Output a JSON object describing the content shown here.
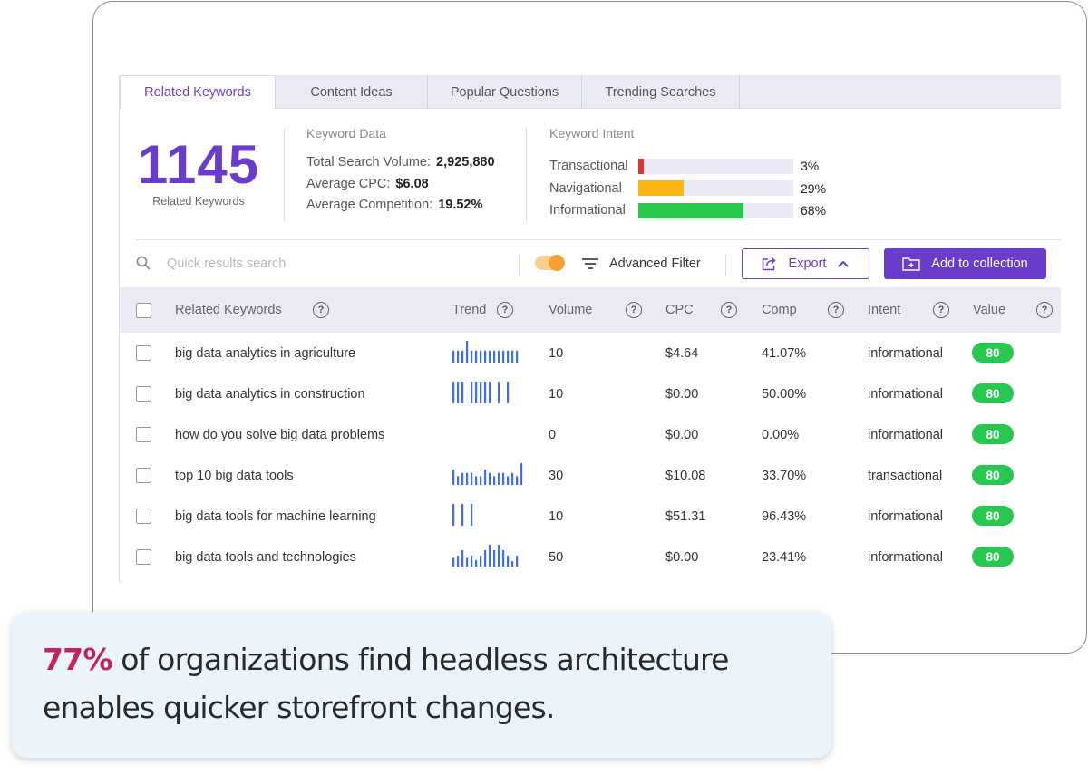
{
  "tabs": [
    {
      "label": "Related Keywords",
      "active": true
    },
    {
      "label": "Content Ideas",
      "active": false
    },
    {
      "label": "Popular Questions",
      "active": false
    },
    {
      "label": "Trending Searches",
      "active": false
    }
  ],
  "summary": {
    "count": "1145",
    "count_label": "Related Keywords",
    "keyword_data": {
      "title": "Keyword Data",
      "rows": [
        {
          "label": "Total Search Volume:",
          "value": "2,925,880"
        },
        {
          "label": "Average CPC:",
          "value": "$6.08"
        },
        {
          "label": "Average Competition:",
          "value": "19.52%"
        }
      ]
    },
    "keyword_intent": {
      "title": "Keyword Intent",
      "rows": [
        {
          "label": "Transactional",
          "value": "3%",
          "percent": 3,
          "color": "#d63a2a"
        },
        {
          "label": "Navigational",
          "value": "29%",
          "percent": 29,
          "color": "#fbb614"
        },
        {
          "label": "Informational",
          "value": "68%",
          "percent": 68,
          "color": "#28c850"
        }
      ]
    }
  },
  "toolbar": {
    "search_placeholder": "Quick results search",
    "search_value": "",
    "toggle_on": true,
    "advanced_filter_label": "Advanced Filter",
    "export_label": "Export",
    "add_collection_label": "Add to collection"
  },
  "table": {
    "headers": {
      "keyword": "Related Keywords",
      "trend": "Trend",
      "volume": "Volume",
      "cpc": "CPC",
      "comp": "Comp",
      "intent": "Intent",
      "value": "Value"
    },
    "help_glyph": "?",
    "rows": [
      {
        "keyword": "big data analytics in agriculture",
        "volume": "10",
        "cpc": "$4.64",
        "comp": "41.07%",
        "intent": "informational",
        "value": "80",
        "trend": [
          0.55,
          0.55,
          0.55,
          1.0,
          0.55,
          0.55,
          0.55,
          0.55,
          0.55,
          0.55,
          0.55,
          0.55,
          0.55,
          0.55,
          0.55
        ]
      },
      {
        "keyword": "big data analytics in construction",
        "volume": "10",
        "cpc": "$0.00",
        "comp": "50.00%",
        "intent": "informational",
        "value": "80",
        "trend": [
          1,
          1,
          1,
          0,
          1,
          1,
          1,
          1,
          1,
          0,
          1,
          0,
          1
        ]
      },
      {
        "keyword": "how do you solve big data problems",
        "volume": "0",
        "cpc": "$0.00",
        "comp": "0.00%",
        "intent": "informational",
        "value": "80",
        "trend": []
      },
      {
        "keyword": "top 10 big data tools",
        "volume": "30",
        "cpc": "$10.08",
        "comp": "33.70%",
        "intent": "transactional",
        "value": "80",
        "trend": [
          0.7,
          0.4,
          0.55,
          0.55,
          0.55,
          0.4,
          0.4,
          0.7,
          0.55,
          0.4,
          0.55,
          0.55,
          0.4,
          0.55,
          0.4,
          1.0
        ]
      },
      {
        "keyword": "big data tools for machine learning",
        "volume": "10",
        "cpc": "$51.31",
        "comp": "96.43%",
        "intent": "informational",
        "value": "80",
        "trend": [
          1,
          0,
          1,
          0,
          1
        ]
      },
      {
        "keyword": "big data tools and technologies",
        "volume": "50",
        "cpc": "$0.00",
        "comp": "23.41%",
        "intent": "informational",
        "value": "80",
        "trend": [
          0.4,
          0.5,
          0.75,
          0.4,
          0.5,
          0.3,
          0.5,
          0.75,
          1.0,
          0.75,
          1.0,
          0.75,
          0.5,
          0.25,
          0.5
        ]
      }
    ]
  },
  "callout": {
    "highlight": "77%",
    "text": " of organizations find headless architecture enables quicker storefront changes."
  }
}
